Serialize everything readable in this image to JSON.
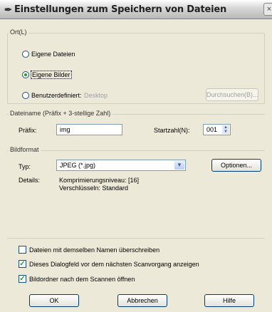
{
  "window": {
    "title": "Einstellungen zum Speichern von Dateien",
    "close_glyph": "×"
  },
  "ort": {
    "group_label": "Ort(L)",
    "options": [
      {
        "label": "Eigene Dateien",
        "selected": false
      },
      {
        "label": "Eigene Bilder",
        "selected": true
      },
      {
        "label": "Benutzerdefiniert:",
        "selected": false,
        "path": "Desktop"
      }
    ],
    "browse_label": "Durchsuchen(B)..."
  },
  "dateiname": {
    "group_label": "Dateiname (Präfix + 3-stellige Zahl)",
    "prefix_label": "Präfix:",
    "prefix_value": "img",
    "start_label": "Startzahl(N):",
    "start_value": "001"
  },
  "bildformat": {
    "group_label": "Bildformat",
    "type_label": "Typ:",
    "type_value": "JPEG (*.jpg)",
    "options_label": "Optionen...",
    "details_label": "Details:",
    "details_line1": "Komprimierungsniveau: [16]",
    "details_line2": "Verschlüsseln: Standard"
  },
  "checkboxes": [
    {
      "label": "Dateien mit demselben Namen überschreiben",
      "checked": false
    },
    {
      "label": "Dieses Dialogfeld vor dem nächsten Scanvorgang anzeigen",
      "checked": true
    },
    {
      "label": "Bildordner nach dem Scannen öffnen",
      "checked": true
    }
  ],
  "buttons": {
    "ok": "OK",
    "cancel": "Abbrechen",
    "help": "Hilfe"
  },
  "colors": {
    "accent": "#21a121",
    "border": "#7f9db9"
  }
}
